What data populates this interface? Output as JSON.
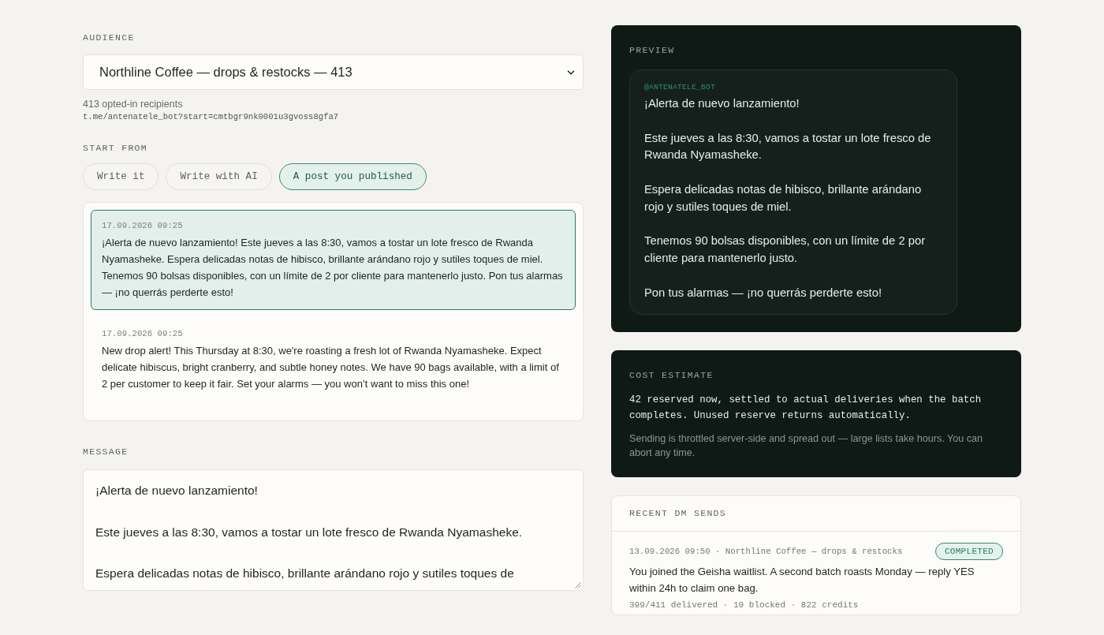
{
  "audience": {
    "label": "AUDIENCE",
    "value": "Northline Coffee — drops & restocks — 413",
    "recipients": "413 opted-in recipients",
    "link": "t.me/antenatele_bot?start=cmtbgr9nk0001u3gvoss8gfa7"
  },
  "start_from": {
    "label": "START FROM",
    "options": [
      {
        "label": "Write it",
        "selected": false
      },
      {
        "label": "Write with AI",
        "selected": false
      },
      {
        "label": "A post you published",
        "selected": true
      }
    ]
  },
  "posts": [
    {
      "date": "17.09.2026 09:25",
      "text": "¡Alerta de nuevo lanzamiento! Este jueves a las 8:30, vamos a tostar un lote fresco de Rwanda Nyamasheke. Espera delicadas notas de hibisco, brillante arándano rojo y sutiles toques de miel. Tenemos 90 bolsas disponibles, con un límite de 2 por cliente para mantenerlo justo. Pon tus alarmas — ¡no querrás perderte esto!",
      "selected": true
    },
    {
      "date": "17.09.2026 09:25",
      "text": "New drop alert! This Thursday at 8:30, we're roasting a fresh lot of Rwanda Nyamasheke. Expect delicate hibiscus, bright cranberry, and subtle honey notes. We have 90 bags available, with a limit of 2 per customer to keep it fair. Set your alarms — you won’t want to miss this one!",
      "selected": false
    }
  ],
  "message": {
    "label": "MESSAGE",
    "value": "¡Alerta de nuevo lanzamiento!\n\nEste jueves a las 8:30, vamos a tostar un lote fresco de Rwanda Nyamasheke.\n\nEspera delicadas notas de hibisco, brillante arándano rojo y sutiles toques de"
  },
  "preview": {
    "label": "PREVIEW",
    "sender": "@ANTENATELE_BOT",
    "text": "¡Alerta de nuevo lanzamiento!\n\nEste jueves a las 8:30, vamos a tostar un lote fresco de Rwanda Nyamasheke.\n\nEspera delicadas notas de hibisco, brillante arándano rojo y sutiles toques de miel.\n\nTenemos 90 bolsas disponibles, con un límite de 2 por cliente para mantenerlo justo.\n\nPon tus alarmas — ¡no querrás perderte esto!"
  },
  "cost_estimate": {
    "label": "COST ESTIMATE",
    "summary": "42 reserved now, settled to actual deliveries when the batch completes. Unused reserve returns automatically.",
    "note": "Sending is throttled server-side and spread out — large lists take hours. You can abort any time."
  },
  "recent_sends": {
    "label": "RECENT DM SENDS",
    "items": [
      {
        "meta": "13.09.2026 09:50 · Northline Coffee — drops & restocks",
        "status": "COMPLETED",
        "text": "You joined the Geisha waitlist. A second batch roasts Monday — reply YES within 24h to claim one bag.",
        "stats": "399/411 delivered · 10 blocked · 822 credits"
      }
    ]
  }
}
